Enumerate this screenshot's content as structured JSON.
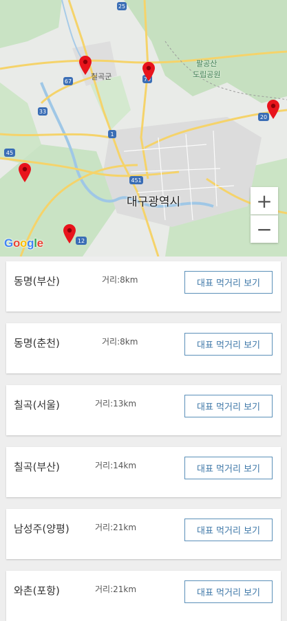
{
  "map": {
    "city_label": "대구광역시",
    "park_label_line1": "팔공산",
    "park_label_line2": "도립공원",
    "district_label": "칠곡군",
    "zoom_in": "+",
    "zoom_out": "−",
    "google_logo": [
      "G",
      "o",
      "o",
      "g",
      "l",
      "e"
    ],
    "google_colors": [
      "#4285F4",
      "#EA4335",
      "#FBBC05",
      "#4285F4",
      "#34A853",
      "#EA4335"
    ],
    "road_numbers": [
      "25",
      "67",
      "79",
      "33",
      "1",
      "451",
      "45",
      "12",
      "20"
    ],
    "pin_color": "#e8141c"
  },
  "list": {
    "button_label": "대표 먹거리 보기",
    "items": [
      {
        "name": "동명(부산)",
        "distance": "거리:8km"
      },
      {
        "name": "동명(춘천)",
        "distance": "거리:8km"
      },
      {
        "name": "칠곡(서울)",
        "distance": "거리:13km"
      },
      {
        "name": "칠곡(부산)",
        "distance": "거리:14km"
      },
      {
        "name": "남성주(양평)",
        "distance": "거리:21km"
      },
      {
        "name": "와촌(포항)",
        "distance": "거리:21km"
      }
    ]
  }
}
